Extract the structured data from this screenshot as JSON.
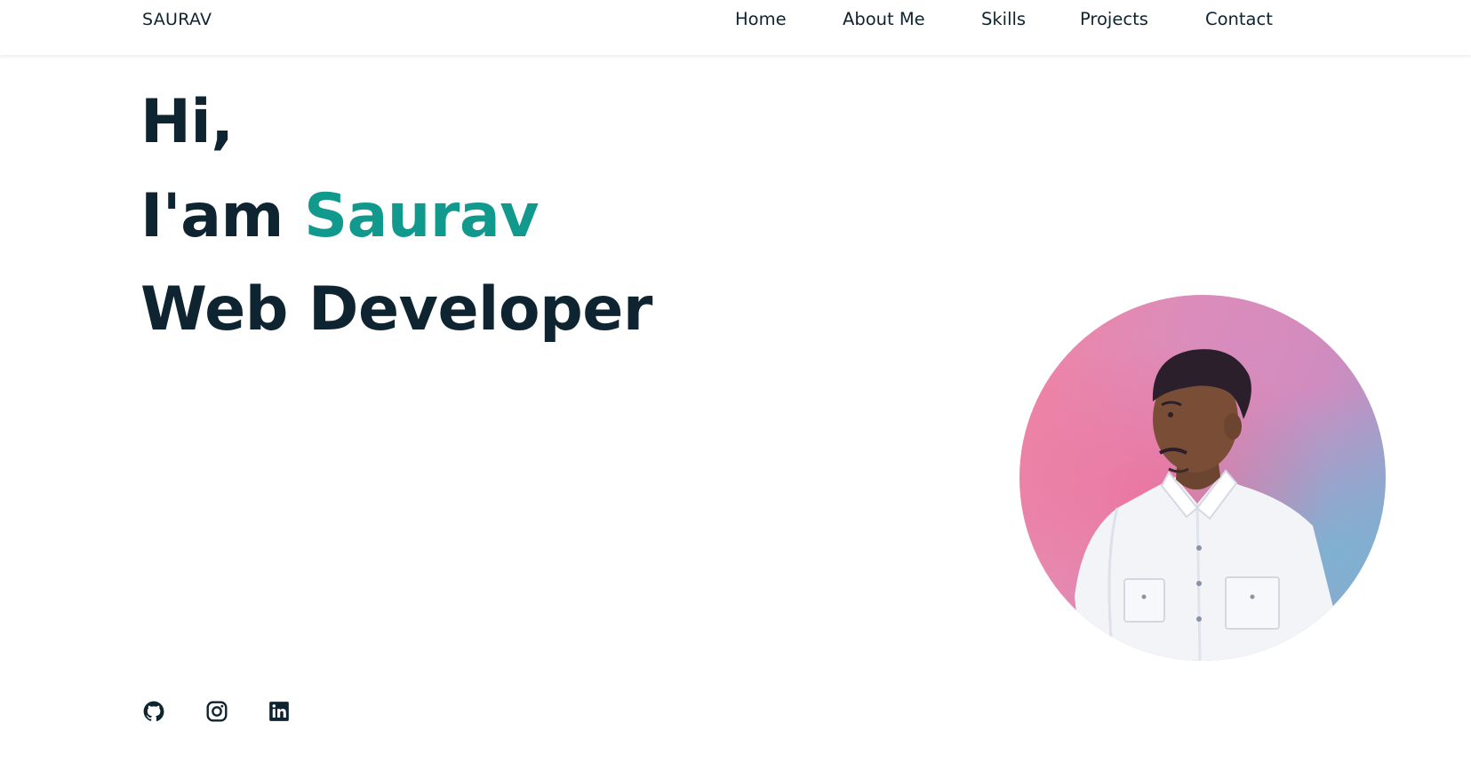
{
  "header": {
    "logo": "SAURAV",
    "nav": [
      "Home",
      "About Me",
      "Skills",
      "Projects",
      "Contact"
    ]
  },
  "hero": {
    "greeting": "Hi,",
    "intro_prefix": "I'am",
    "name": "Saurav",
    "role": "Web Developer"
  },
  "social": [
    {
      "icon": "github-icon"
    },
    {
      "icon": "instagram-icon"
    },
    {
      "icon": "linkedin-icon"
    }
  ],
  "colors": {
    "text": "#0e2431",
    "accent": "#11998e",
    "background": "#ffffff"
  }
}
